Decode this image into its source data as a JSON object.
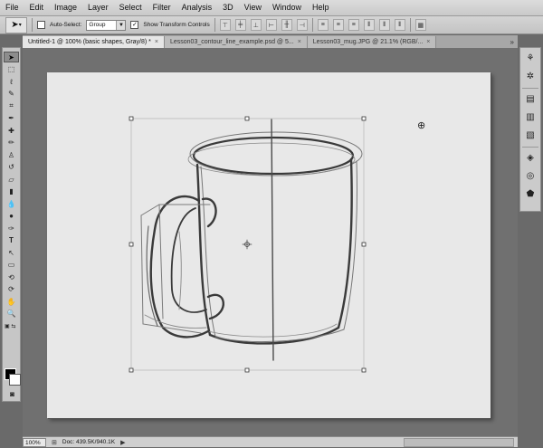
{
  "menu": [
    "File",
    "Edit",
    "Image",
    "Layer",
    "Select",
    "Filter",
    "Analysis",
    "3D",
    "View",
    "Window",
    "Help"
  ],
  "options": {
    "auto_select_label": "Auto-Select:",
    "auto_select_checked": false,
    "group_value": "Group",
    "show_transform_label": "Show Transform Controls",
    "show_transform_checked": true
  },
  "tabs": [
    {
      "label": "Untitled-1 @ 100% (basic shapes, Gray/8) *",
      "active": true
    },
    {
      "label": "Lesson03_contour_line_example.psd @ 5...",
      "active": false
    },
    {
      "label": "Lesson03_mug.JPG @ 21.1% (RGB/...",
      "active": false
    }
  ],
  "tabs_more": "»",
  "status": {
    "zoom": "100%",
    "doc": "Doc: 439.5K/940.1K"
  },
  "icons": {
    "move_tool": "move-arrow-icon",
    "zoom_cursor": "zoom-in-icon"
  }
}
